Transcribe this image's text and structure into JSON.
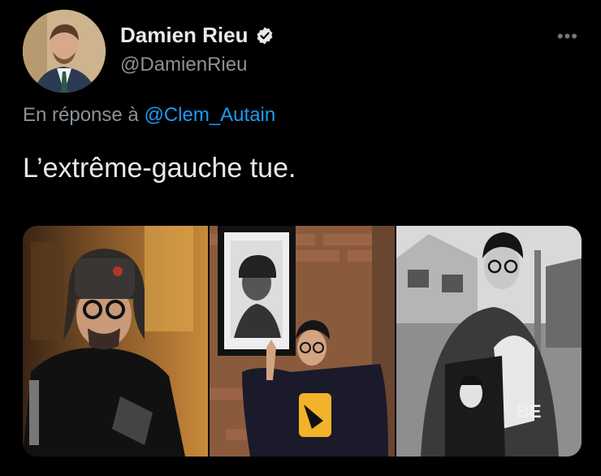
{
  "tweet": {
    "author": {
      "display_name": "Damien Rieu",
      "handle": "@DamienRieu",
      "verified": true
    },
    "more_label": "•••",
    "reply": {
      "prefix": "En réponse à",
      "mention": "@Clem_Autain"
    },
    "text": "L’extrême-gauche tue.",
    "media": {
      "count": 3,
      "photo_3_shirt_text": "BE"
    }
  },
  "colors": {
    "background": "#000000",
    "text_primary": "#e7e9ea",
    "text_secondary": "#8b9299",
    "accent": "#1d9bf0"
  },
  "icons": {
    "verified": "verified-badge-icon",
    "more": "more-options-icon"
  }
}
